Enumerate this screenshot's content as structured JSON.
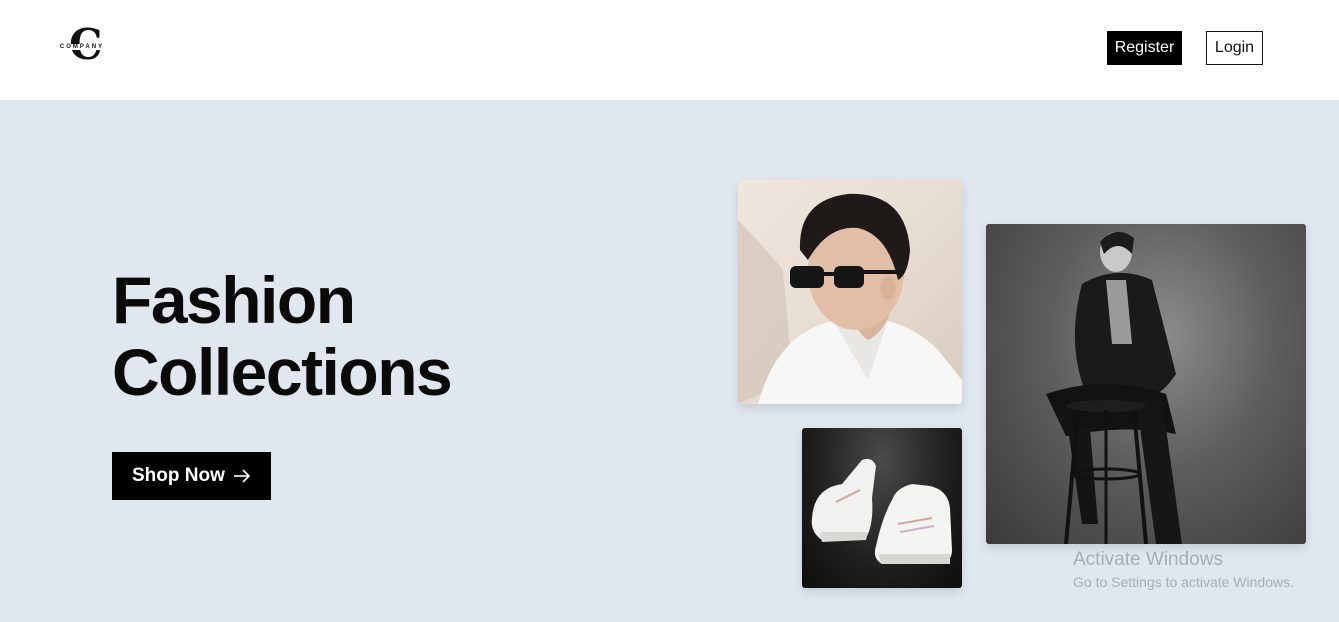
{
  "header": {
    "logo": {
      "letter": "C",
      "word": "COMPANY"
    },
    "register_label": "Register",
    "login_label": "Login"
  },
  "hero": {
    "title_line1": "Fashion",
    "title_line2": "Collections",
    "cta_label": "Shop Now",
    "cta_icon": "arrow-right-icon",
    "background": "#e1e7ef"
  },
  "gallery": {
    "images": [
      {
        "subject": "man with sunglasses"
      },
      {
        "subject": "woman in suit on stool"
      },
      {
        "subject": "white sneakers"
      }
    ]
  },
  "watermark": {
    "title": "Activate Windows",
    "subtitle": "Go to Settings to activate Windows."
  },
  "colors": {
    "primary": "#000000",
    "hero_bg": "#e1e7ef",
    "header_bg": "#ffffff"
  }
}
